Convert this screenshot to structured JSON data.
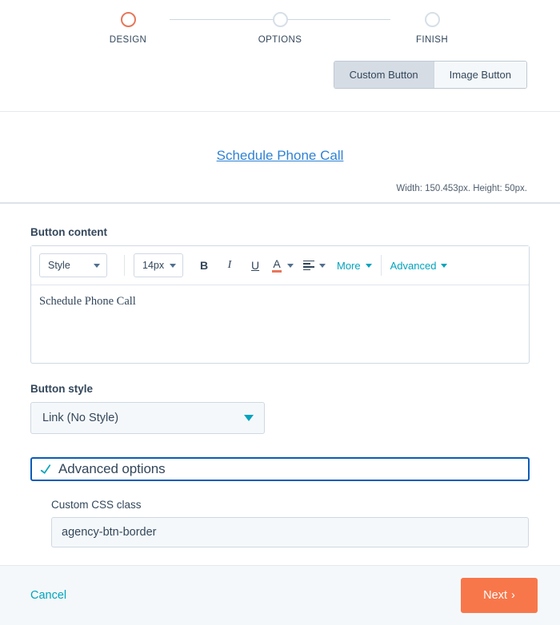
{
  "stepper": {
    "steps": [
      {
        "label": "DESIGN",
        "state": "active"
      },
      {
        "label": "OPTIONS",
        "state": "inactive"
      },
      {
        "label": "FINISH",
        "state": "inactive"
      }
    ],
    "active_color": "#e8765a",
    "inactive_color": "#d6dfe8"
  },
  "tabs": [
    {
      "label": "Custom Button",
      "selected": true
    },
    {
      "label": "Image Button",
      "selected": false
    }
  ],
  "preview": {
    "link_text": "Schedule Phone Call",
    "link_color": "#2f82d4",
    "dimensions": "Width: 150.453px. Height: 50px."
  },
  "button_content": {
    "label": "Button content",
    "toolbar": {
      "style_select": "Style",
      "size_select": "14px",
      "bold": "B",
      "italic": "I",
      "underline": "U",
      "text_color": "A",
      "text_color_swatch": "#e8765a",
      "align": "align-left",
      "more": "More",
      "advanced": "Advanced"
    },
    "editor_text": "Schedule Phone Call"
  },
  "button_style": {
    "label": "Button style",
    "value": "Link (No Style)"
  },
  "advanced_options": {
    "title": "Advanced options",
    "expanded": true,
    "focus_color": "#0a5cb8",
    "custom_css": {
      "label": "Custom CSS class",
      "value": "agency-btn-border"
    }
  },
  "footer": {
    "cancel_label": "Cancel",
    "next_label": "Next",
    "next_chevron": "›",
    "next_color": "#f8774a",
    "cancel_color": "#00a4bd"
  }
}
